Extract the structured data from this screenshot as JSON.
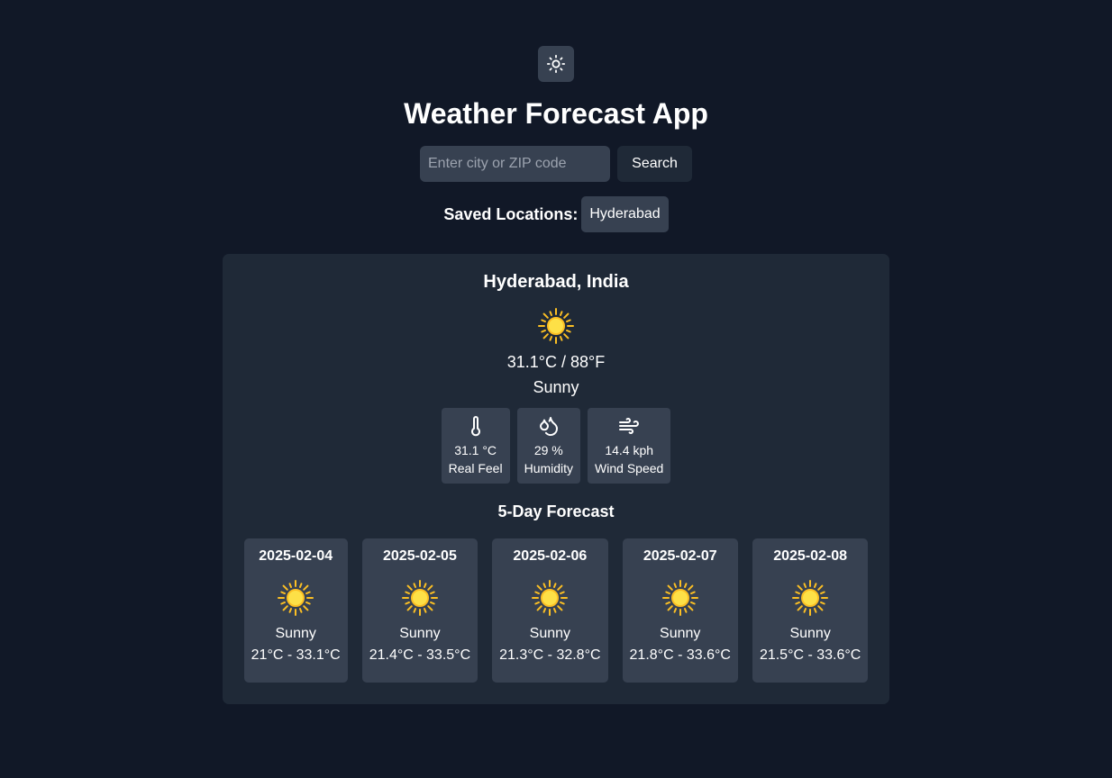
{
  "header": {
    "theme_icon": "sun-outline-icon",
    "title": "Weather Forecast App"
  },
  "search": {
    "placeholder": "Enter city or ZIP code",
    "value": "",
    "button_label": "Search"
  },
  "saved": {
    "label": "Saved Locations:",
    "locations": [
      "Hyderabad"
    ]
  },
  "current": {
    "location": "Hyderabad, India",
    "icon": "sun-icon",
    "temperature": "31.1°C / 88°F",
    "condition": "Sunny",
    "stats": [
      {
        "icon": "thermometer-icon",
        "value": "31.1 °C",
        "label": "Real Feel"
      },
      {
        "icon": "droplets-icon",
        "value": "29 %",
        "label": "Humidity"
      },
      {
        "icon": "wind-icon",
        "value": "14.4 kph",
        "label": "Wind Speed"
      }
    ]
  },
  "forecast": {
    "title": "5-Day Forecast",
    "days": [
      {
        "date": "2025-02-04",
        "icon": "sun-icon",
        "condition": "Sunny",
        "range": "21°C - 33.1°C"
      },
      {
        "date": "2025-02-05",
        "icon": "sun-icon",
        "condition": "Sunny",
        "range": "21.4°C - 33.5°C"
      },
      {
        "date": "2025-02-06",
        "icon": "sun-icon",
        "condition": "Sunny",
        "range": "21.3°C - 32.8°C"
      },
      {
        "date": "2025-02-07",
        "icon": "sun-icon",
        "condition": "Sunny",
        "range": "21.8°C - 33.6°C"
      },
      {
        "date": "2025-02-08",
        "icon": "sun-icon",
        "condition": "Sunny",
        "range": "21.5°C - 33.6°C"
      }
    ]
  },
  "colors": {
    "background": "#111827",
    "card": "#1f2937",
    "tile": "#374151",
    "sun": "#fbbf24"
  }
}
